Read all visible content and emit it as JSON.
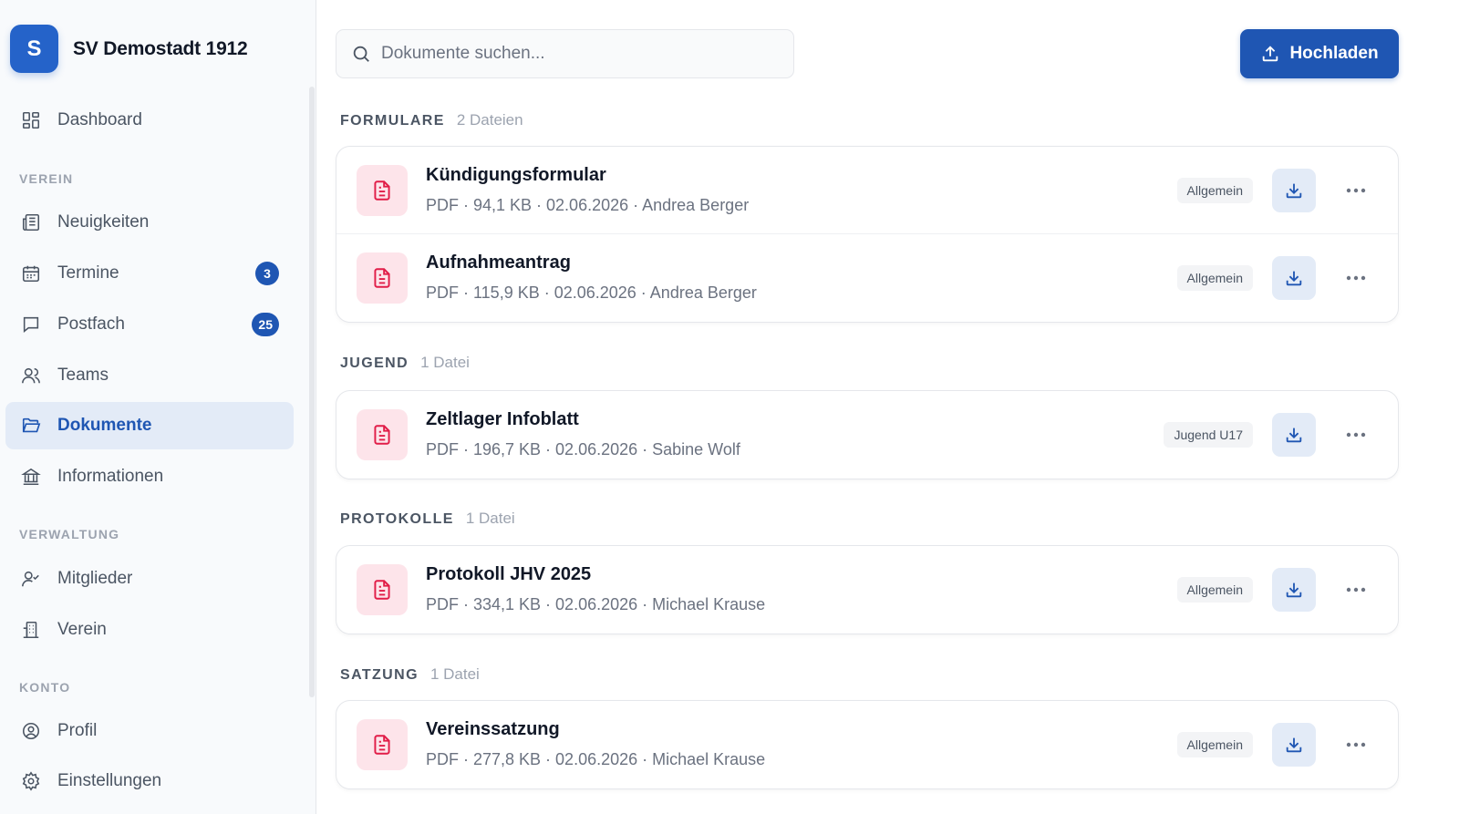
{
  "brand": {
    "initial": "S",
    "name": "SV Demostadt 1912"
  },
  "nav": {
    "dashboard": "Dashboard",
    "sections": {
      "verein": "VEREIN",
      "verwaltung": "VERWALTUNG",
      "konto": "KONTO"
    },
    "items": {
      "neuigkeiten": "Neuigkeiten",
      "termine": "Termine",
      "termine_badge": "3",
      "postfach": "Postfach",
      "postfach_badge": "25",
      "teams": "Teams",
      "dokumente": "Dokumente",
      "informationen": "Informationen",
      "mitglieder": "Mitglieder",
      "verein": "Verein",
      "profil": "Profil",
      "einstellungen": "Einstellungen"
    },
    "active": "Dokumente"
  },
  "search": {
    "placeholder": "Dokumente suchen...",
    "value": ""
  },
  "upload_label": "Hochladen",
  "colors": {
    "accent": "#1f56b3",
    "file_icon": "#e11d48",
    "file_icon_bg": "#fde4ea"
  },
  "groups": [
    {
      "title": "FORMULARE",
      "count": "2 Dateien",
      "files": [
        {
          "name": "Kündigungsformular",
          "meta": "PDF · 94,1 KB · 02.06.2026 · Andrea Berger",
          "tag": "Allgemein"
        },
        {
          "name": "Aufnahmeantrag",
          "meta": "PDF · 115,9 KB · 02.06.2026 · Andrea Berger",
          "tag": "Allgemein"
        }
      ]
    },
    {
      "title": "JUGEND",
      "count": "1 Datei",
      "files": [
        {
          "name": "Zeltlager Infoblatt",
          "meta": "PDF · 196,7 KB · 02.06.2026 · Sabine Wolf",
          "tag": "Jugend U17"
        }
      ]
    },
    {
      "title": "PROTOKOLLE",
      "count": "1 Datei",
      "files": [
        {
          "name": "Protokoll JHV 2025",
          "meta": "PDF · 334,1 KB · 02.06.2026 · Michael Krause",
          "tag": "Allgemein"
        }
      ]
    },
    {
      "title": "SATZUNG",
      "count": "1 Datei",
      "files": [
        {
          "name": "Vereinssatzung",
          "meta": "PDF · 277,8 KB · 02.06.2026 · Michael Krause",
          "tag": "Allgemein"
        }
      ]
    }
  ]
}
